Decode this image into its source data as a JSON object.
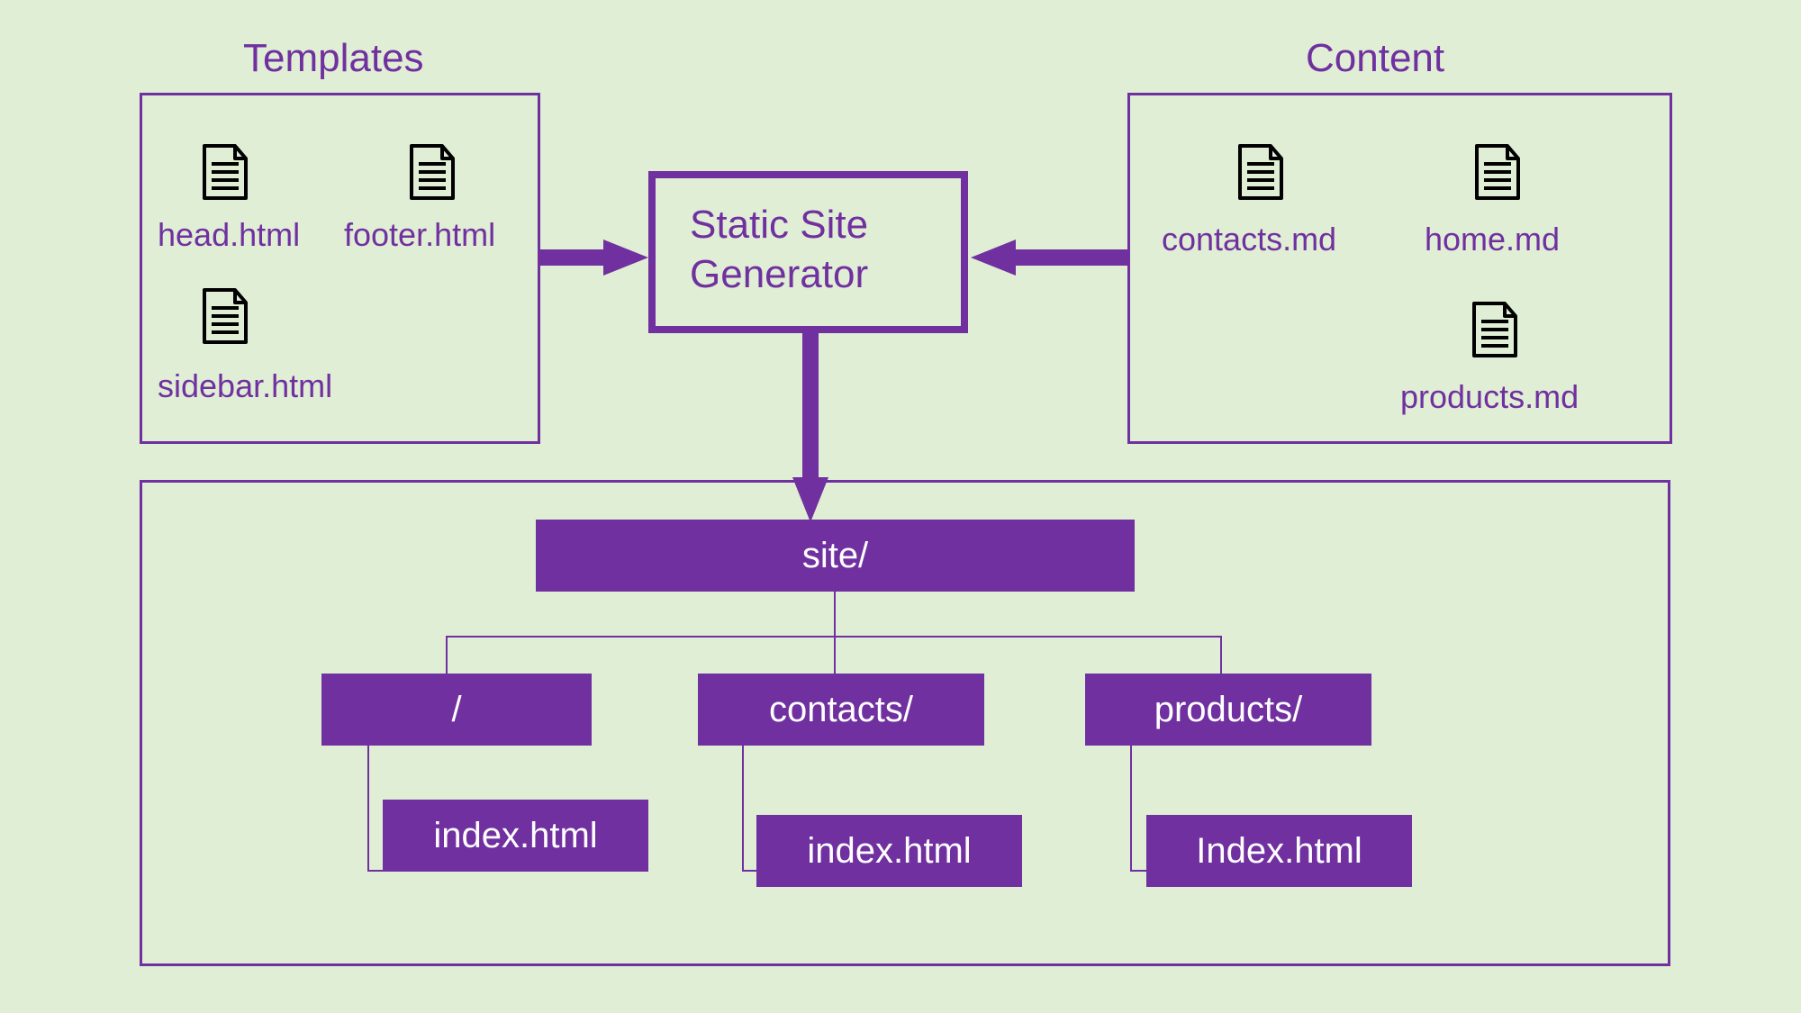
{
  "templates": {
    "title": "Templates",
    "files": [
      "head.html",
      "footer.html",
      "sidebar.html"
    ]
  },
  "content": {
    "title": "Content",
    "files": [
      "contacts.md",
      "home.md",
      "products.md"
    ]
  },
  "generator": {
    "line1": "Static Site",
    "line2": "Generator"
  },
  "output": {
    "root": "site/",
    "dirs": [
      "/",
      "contacts/",
      "products/"
    ],
    "files": [
      "index.html",
      "index.html",
      "Index.html"
    ]
  },
  "colors": {
    "accent": "#7030a0",
    "bg": "#dfeed4",
    "node_fg": "#ffffff"
  }
}
